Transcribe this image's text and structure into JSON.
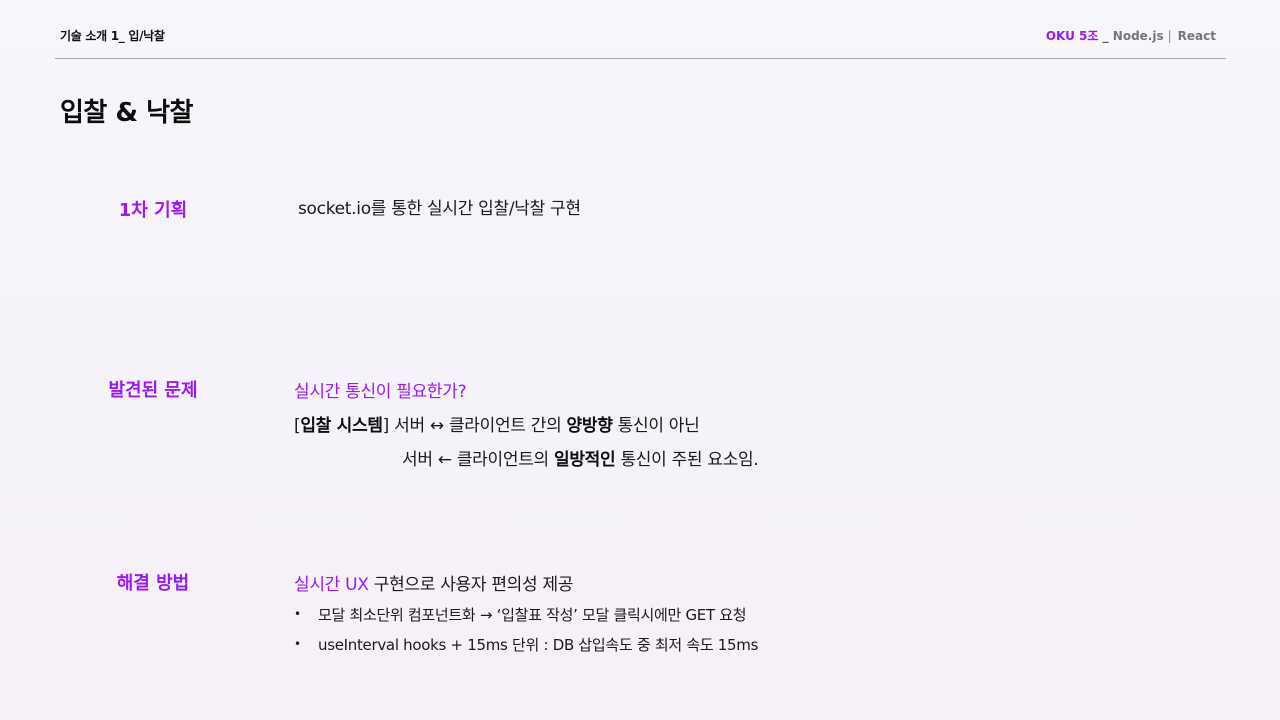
{
  "header": {
    "section_label": "기술 소개 1_ 입/낙찰",
    "team": "OKU 5조",
    "separator": " _ ",
    "tech1": "Node.js",
    "divider": "|",
    "tech2": "React"
  },
  "title": "입찰 & 낙찰",
  "rows": {
    "plan": {
      "label": "1차 기획",
      "text": "socket.io를 통한 실시간 입찰/낙찰  구현"
    },
    "problem": {
      "label": "발견된 문제",
      "question": "실시간 통신이 필요한가?",
      "line1": {
        "bracket_open": "[",
        "bold_term": "입찰 시스템",
        "bracket_close": "]",
        "text_a": " 서버 ↔ 클라이언트 간의 ",
        "bold_word": "양방향",
        "text_b": " 통신이 아닌"
      },
      "line2": {
        "text_a": "서버 ← 클라이언트의 ",
        "bold_word": "일방적인",
        "text_b": " 통신이 주된 요소임."
      }
    },
    "solution": {
      "label": "해결 방법",
      "accent": "실시간 UX",
      "text": "  구현으로 사용자 편의성 제공",
      "bullet_symbol": "•",
      "bullets": [
        "모달 최소단위 컴포넌트화 → ‘입찰표 작성’ 모달 클릭시에만 GET 요청",
        "useInterval hooks + 15ms 단위 : DB 삽입속도 중 최저 속도 15ms"
      ]
    }
  }
}
